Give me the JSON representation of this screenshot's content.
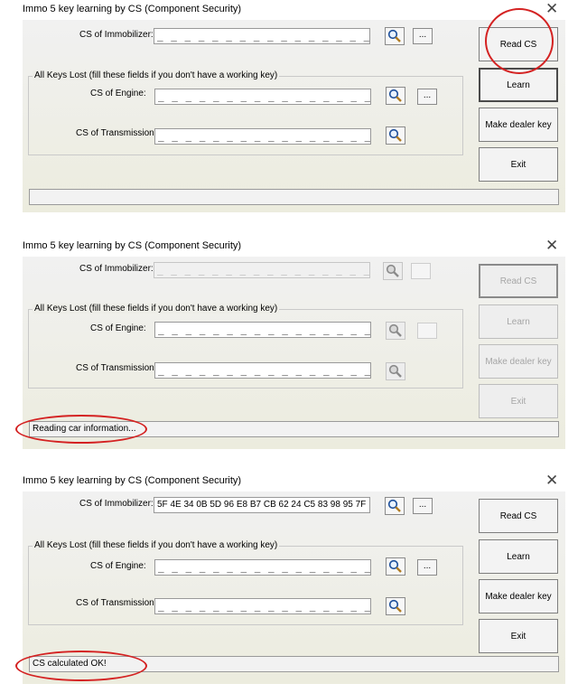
{
  "window_title": "Immo 5 key learning by CS (Component Security)",
  "close_glyph": "✕",
  "labels": {
    "immobilizer": "CS of Immobilizer:",
    "group_legend": "All Keys Lost (fill these fields if you don't have a working key)",
    "engine": "CS of Engine:",
    "transmission": "CS of Transmission:"
  },
  "buttons": {
    "read_cs": "Read CS",
    "learn": "Learn",
    "make_dealer_key": "Make dealer key",
    "exit": "Exit",
    "browse": "..."
  },
  "icons": {
    "search": "magnifier-icon"
  },
  "colors": {
    "annotation_red": "#d42222"
  },
  "mask": "_ _ _ _ _ _ _ _ _ _ _ _ _ _ _ _ _ _",
  "panels": [
    {
      "state": "idle",
      "immobilizer_value": "",
      "status": ""
    },
    {
      "state": "reading",
      "immobilizer_value": "",
      "status": "Reading car information..."
    },
    {
      "state": "done",
      "immobilizer_value": "5F 4E 34 0B 5D 96 E8 B7 CB 62 24 C5 83 98 95 7F",
      "status": "CS calculated OK!"
    }
  ]
}
